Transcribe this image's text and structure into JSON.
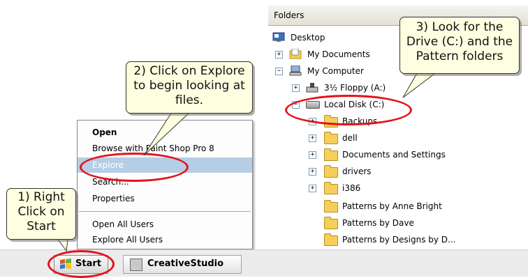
{
  "folders": {
    "header": "Folders",
    "items": [
      {
        "label": "Desktop",
        "icon": "desktop-icon"
      },
      {
        "label": "My Documents",
        "icon": "my-documents-icon",
        "expander": "+"
      },
      {
        "label": "My Computer",
        "icon": "my-computer-icon",
        "expander": "−"
      },
      {
        "label": "3½ Floppy (A:)",
        "icon": "floppy-drive-icon",
        "expander": "+"
      },
      {
        "label": "Local Disk (C:)",
        "icon": "hard-drive-icon",
        "expander": "−"
      },
      {
        "label": "Backups",
        "icon": "folder-icon",
        "expander": "+"
      },
      {
        "label": "dell",
        "icon": "folder-icon",
        "expander": "+"
      },
      {
        "label": "Documents and Settings",
        "icon": "folder-icon",
        "expander": "+"
      },
      {
        "label": "drivers",
        "icon": "folder-icon",
        "expander": "+"
      },
      {
        "label": "i386",
        "icon": "folder-icon",
        "expander": "+"
      },
      {
        "label": "Patterns by Anne Bright",
        "icon": "folder-icon"
      },
      {
        "label": "Patterns by Dave",
        "icon": "folder-icon"
      },
      {
        "label": "Patterns by Designs by D...",
        "icon": "folder-icon"
      }
    ]
  },
  "context_menu": {
    "items": [
      "Open",
      "Browse with Paint Shop Pro 8",
      "Explore",
      "Search...",
      "Properties",
      "Open All Users",
      "Explore All Users"
    ],
    "selected": "Explore"
  },
  "taskbar": {
    "start_label": "Start",
    "task_label": "CreativeStudio"
  },
  "callouts": {
    "step1": [
      "1) Right",
      "Click on",
      "Start"
    ],
    "step2": [
      "2) Click on Explore",
      "to begin looking at",
      "files."
    ],
    "step3": [
      "3) Look for the",
      "Drive (C:) and the",
      "Pattern folders"
    ]
  },
  "colors": {
    "highlight_oval": "#e3131b",
    "callout_fill": "#fefee0",
    "menu_selection": "#b6cde6",
    "folder_yellow": "#f5cf59"
  }
}
